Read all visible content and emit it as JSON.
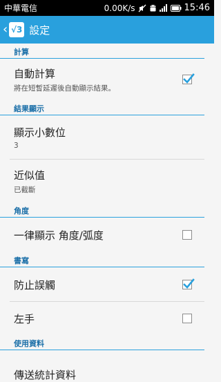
{
  "status_bar": {
    "carrier": "中華電信",
    "net_speed": "0.00K/s",
    "time": "15:46",
    "icons": [
      "mute-icon",
      "android-icon",
      "signal-icon",
      "battery-icon"
    ]
  },
  "app_bar": {
    "title": "設定",
    "logo_text": "√3",
    "accent": "#29a0dd"
  },
  "sections": {
    "calc": {
      "header": "計算"
    },
    "result": {
      "header": "結果顯示"
    },
    "angle": {
      "header": "角度"
    },
    "writing": {
      "header": "書寫"
    },
    "usage": {
      "header": "使用資料"
    }
  },
  "items": {
    "auto_calc": {
      "title": "自動計算",
      "summary": "將在短暫延遲後自動顯示結果。",
      "checked": true
    },
    "decimals": {
      "title": "顯示小數位",
      "summary": "3"
    },
    "approx": {
      "title": "近似值",
      "summary": "已截斷"
    },
    "angle_always": {
      "title": "一律顯示 角度/弧度",
      "checked": false
    },
    "prevent_touch": {
      "title": "防止誤觸",
      "checked": true
    },
    "left_hand": {
      "title": "左手",
      "checked": false
    },
    "send_stats": {
      "title": "傳送統計資料"
    }
  }
}
